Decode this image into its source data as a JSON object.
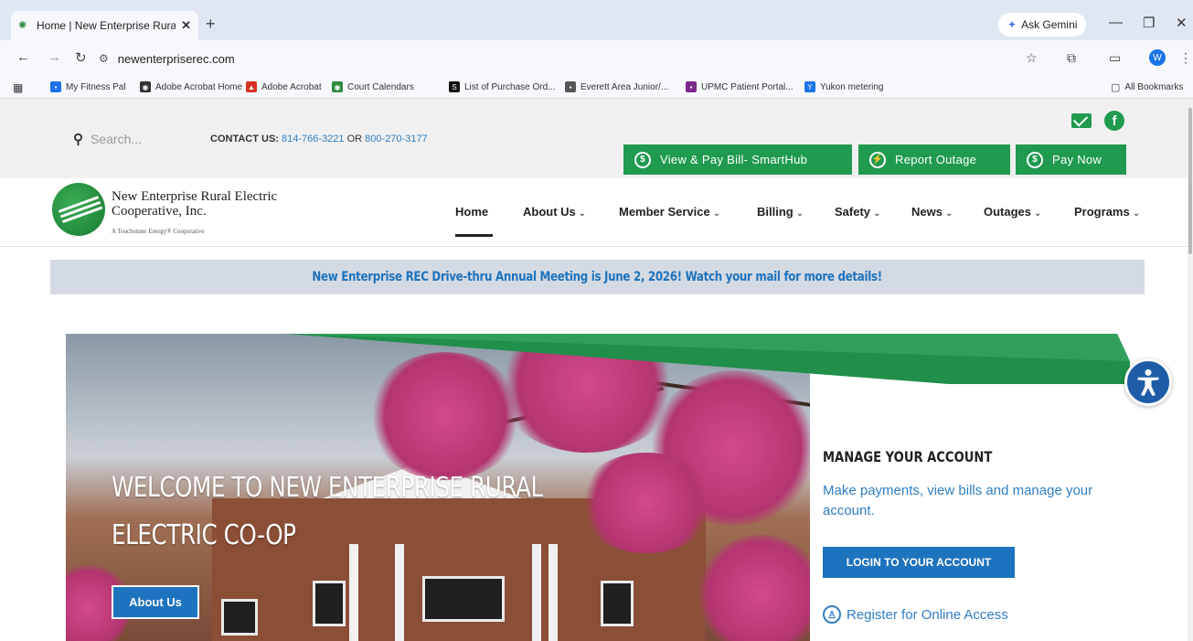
{
  "browser": {
    "tab_title": "Home | New Enterprise Rural E",
    "tab_close": "✕",
    "new_tab": "+",
    "ask_gemini": "Ask Gemini",
    "url": "newenterpriserec.com",
    "bookmarks": [
      {
        "label": "My Fitness Pal",
        "color": "#1a73e8"
      },
      {
        "label": "Adobe Acrobat Home",
        "color": "#333333"
      },
      {
        "label": "Adobe Acrobat",
        "color": "#d93025"
      },
      {
        "label": "Court Calendars",
        "color": "#2d8a3e"
      },
      {
        "label": "List of Purchase Ord...",
        "color": "#111111"
      },
      {
        "label": "Everett Area Junior/...",
        "color": "#555555"
      },
      {
        "label": "UPMC Patient Portal...",
        "color": "#7b2a8c"
      },
      {
        "label": "Yukon metering",
        "color": "#1a73e8"
      }
    ],
    "all_bookmarks": "All Bookmarks",
    "profile_initial": "W"
  },
  "site": {
    "search_placeholder": "Search...",
    "contact_label": "CONTACT US:",
    "phone1": "814-766-3221",
    "contact_or": "OR",
    "phone2": "800-270-3177",
    "buttons": [
      {
        "label": "View & Pay Bill- SmartHub",
        "icon": "$"
      },
      {
        "label": "Report Outage",
        "icon": "⚡"
      },
      {
        "label": "Pay Now",
        "icon": "$"
      }
    ],
    "logo_line1": "New Enterprise Rural Electric",
    "logo_line2": "Cooperative, Inc.",
    "logo_tagline": "A Touchstone Energy® Cooperative",
    "nav": [
      {
        "label": "Home",
        "chevron": ""
      },
      {
        "label": "About Us",
        "chevron": "⌄"
      },
      {
        "label": "Member Service",
        "chevron": "⌄"
      },
      {
        "label": "Billing",
        "chevron": "⌄"
      },
      {
        "label": "Safety",
        "chevron": "⌄"
      },
      {
        "label": "News",
        "chevron": "⌄"
      },
      {
        "label": "Outages",
        "chevron": "⌄"
      },
      {
        "label": "Programs",
        "chevron": "⌄"
      }
    ],
    "announcement": "New Enterprise REC Drive-thru Annual Meeting is June 2, 2026!  Watch your mail for more details!",
    "hero": {
      "welcome_line1": "WELCOME TO NEW ENTERPRISE RURAL",
      "welcome_line2": "ELECTRIC CO-OP",
      "about_button": "About Us"
    },
    "account": {
      "title": "MANAGE YOUR ACCOUNT",
      "description": "Make payments, view bills and manage your account.",
      "login_button": "LOGIN TO YOUR ACCOUNT",
      "register": "Register for Online Access"
    },
    "colors": {
      "brand_green": "#1f9a4f",
      "brand_blue": "#1e73be",
      "link_blue": "#2f7ec3"
    }
  }
}
